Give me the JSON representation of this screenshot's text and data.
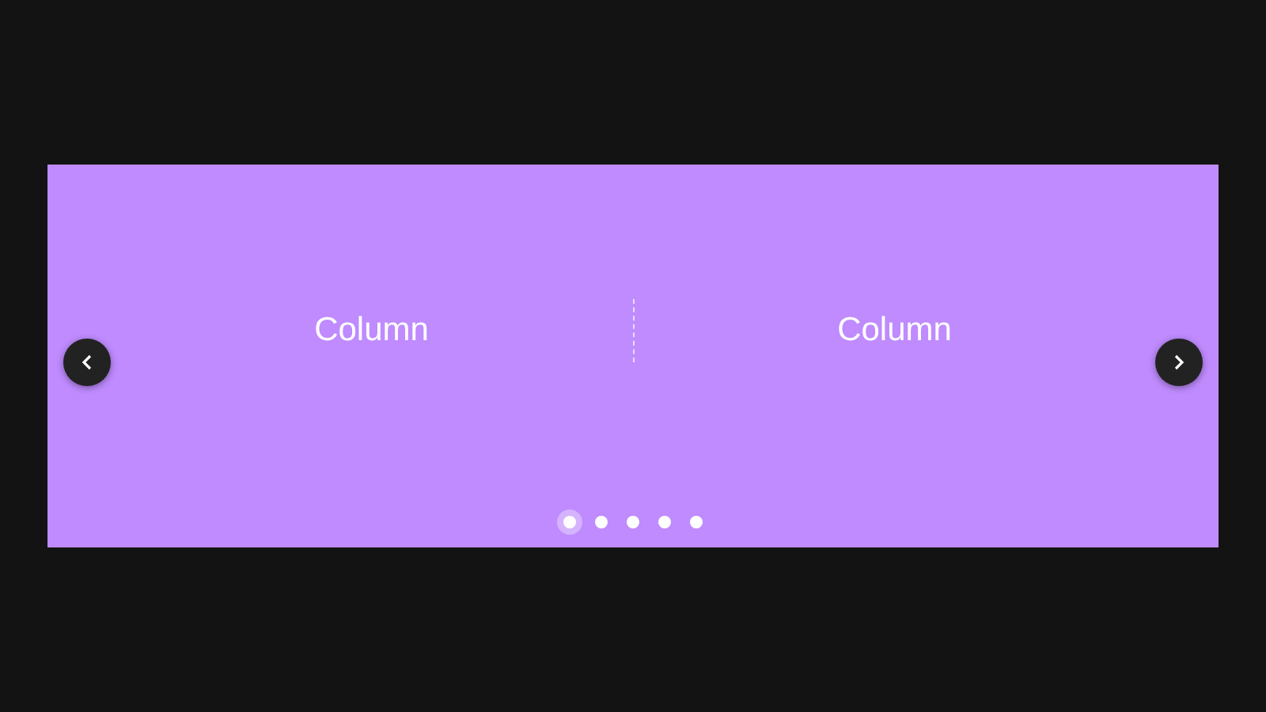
{
  "carousel": {
    "slides": [
      {
        "text": "Column"
      },
      {
        "text": "Column"
      }
    ],
    "dots": [
      {
        "selected": true
      },
      {
        "selected": false
      },
      {
        "selected": false
      },
      {
        "selected": false
      },
      {
        "selected": false
      }
    ]
  }
}
